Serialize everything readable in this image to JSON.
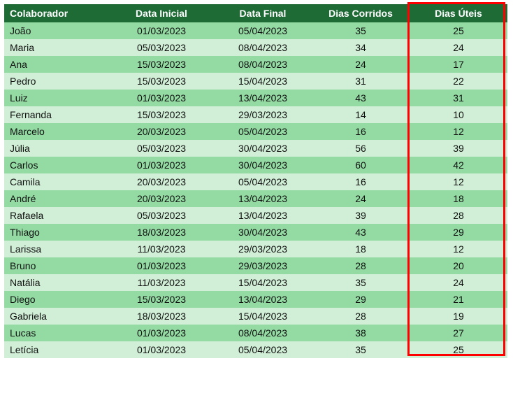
{
  "table": {
    "headers": [
      "Colaborador",
      "Data Inicial",
      "Data Final",
      "Dias Corridos",
      "Dias Úteis"
    ],
    "rows": [
      {
        "colaborador": "João",
        "data_inicial": "01/03/2023",
        "data_final": "05/04/2023",
        "dias_corridos": 35,
        "dias_uteis": 25
      },
      {
        "colaborador": "Maria",
        "data_inicial": "05/03/2023",
        "data_final": "08/04/2023",
        "dias_corridos": 34,
        "dias_uteis": 24
      },
      {
        "colaborador": "Ana",
        "data_inicial": "15/03/2023",
        "data_final": "08/04/2023",
        "dias_corridos": 24,
        "dias_uteis": 17
      },
      {
        "colaborador": "Pedro",
        "data_inicial": "15/03/2023",
        "data_final": "15/04/2023",
        "dias_corridos": 31,
        "dias_uteis": 22
      },
      {
        "colaborador": "Luiz",
        "data_inicial": "01/03/2023",
        "data_final": "13/04/2023",
        "dias_corridos": 43,
        "dias_uteis": 31
      },
      {
        "colaborador": "Fernanda",
        "data_inicial": "15/03/2023",
        "data_final": "29/03/2023",
        "dias_corridos": 14,
        "dias_uteis": 10
      },
      {
        "colaborador": "Marcelo",
        "data_inicial": "20/03/2023",
        "data_final": "05/04/2023",
        "dias_corridos": 16,
        "dias_uteis": 12
      },
      {
        "colaborador": "Júlia",
        "data_inicial": "05/03/2023",
        "data_final": "30/04/2023",
        "dias_corridos": 56,
        "dias_uteis": 39
      },
      {
        "colaborador": "Carlos",
        "data_inicial": "01/03/2023",
        "data_final": "30/04/2023",
        "dias_corridos": 60,
        "dias_uteis": 42
      },
      {
        "colaborador": "Camila",
        "data_inicial": "20/03/2023",
        "data_final": "05/04/2023",
        "dias_corridos": 16,
        "dias_uteis": 12
      },
      {
        "colaborador": "André",
        "data_inicial": "20/03/2023",
        "data_final": "13/04/2023",
        "dias_corridos": 24,
        "dias_uteis": 18
      },
      {
        "colaborador": "Rafaela",
        "data_inicial": "05/03/2023",
        "data_final": "13/04/2023",
        "dias_corridos": 39,
        "dias_uteis": 28
      },
      {
        "colaborador": "Thiago",
        "data_inicial": "18/03/2023",
        "data_final": "30/04/2023",
        "dias_corridos": 43,
        "dias_uteis": 29
      },
      {
        "colaborador": "Larissa",
        "data_inicial": "11/03/2023",
        "data_final": "29/03/2023",
        "dias_corridos": 18,
        "dias_uteis": 12
      },
      {
        "colaborador": "Bruno",
        "data_inicial": "01/03/2023",
        "data_final": "29/03/2023",
        "dias_corridos": 28,
        "dias_uteis": 20
      },
      {
        "colaborador": "Natália",
        "data_inicial": "11/03/2023",
        "data_final": "15/04/2023",
        "dias_corridos": 35,
        "dias_uteis": 24
      },
      {
        "colaborador": "Diego",
        "data_inicial": "15/03/2023",
        "data_final": "13/04/2023",
        "dias_corridos": 29,
        "dias_uteis": 21
      },
      {
        "colaborador": "Gabriela",
        "data_inicial": "18/03/2023",
        "data_final": "15/04/2023",
        "dias_corridos": 28,
        "dias_uteis": 19
      },
      {
        "colaborador": "Lucas",
        "data_inicial": "01/03/2023",
        "data_final": "08/04/2023",
        "dias_corridos": 38,
        "dias_uteis": 27
      },
      {
        "colaborador": "Letícia",
        "data_inicial": "01/03/2023",
        "data_final": "05/04/2023",
        "dias_corridos": 35,
        "dias_uteis": 25
      }
    ]
  },
  "highlight": {
    "column_index": 4
  }
}
